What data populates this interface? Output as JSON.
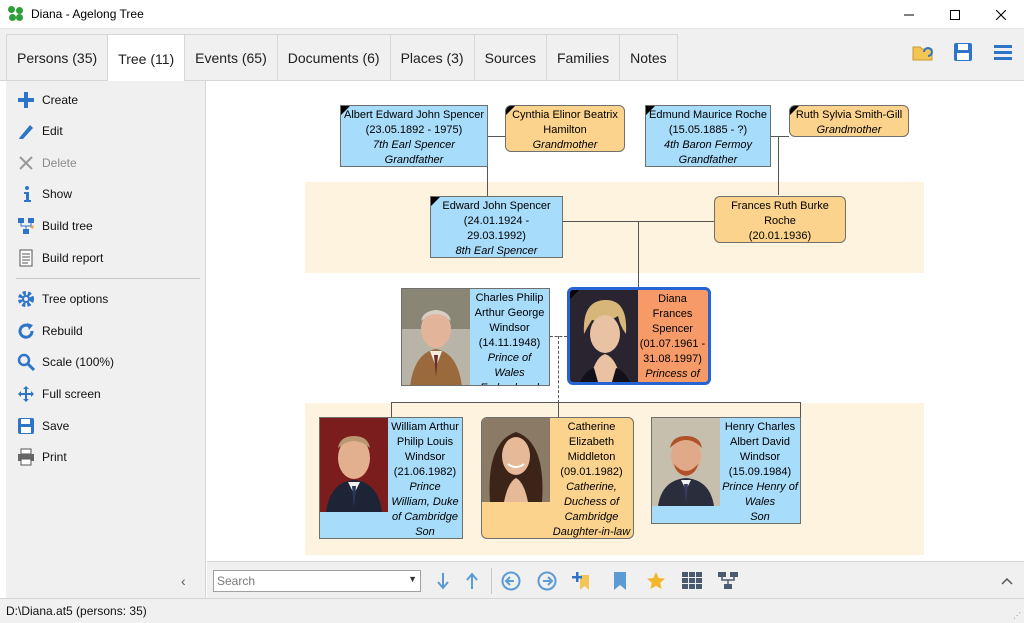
{
  "window": {
    "title": "Diana - Agelong Tree",
    "minimize": "—",
    "maximize": "☐",
    "close": "✕"
  },
  "tabs": [
    {
      "label": "Persons (35)"
    },
    {
      "label": "Tree (11)"
    },
    {
      "label": "Events (65)"
    },
    {
      "label": "Documents (6)"
    },
    {
      "label": "Places (3)"
    },
    {
      "label": "Sources"
    },
    {
      "label": "Families"
    },
    {
      "label": "Notes"
    }
  ],
  "toolbar_icons": [
    "open-folder-icon",
    "save-icon",
    "hamburger-menu-icon"
  ],
  "sidebar": {
    "items": [
      {
        "label": "Create",
        "icon": "plus-icon"
      },
      {
        "label": "Edit",
        "icon": "pencil-icon"
      },
      {
        "label": "Delete",
        "icon": "delete-x-icon"
      },
      {
        "label": "Show",
        "icon": "info-icon"
      },
      {
        "label": "Build tree",
        "icon": "build-tree-icon"
      },
      {
        "label": "Build report",
        "icon": "report-icon"
      },
      {
        "label": "Tree options",
        "icon": "gear-icon"
      },
      {
        "label": "Rebuild",
        "icon": "refresh-icon"
      },
      {
        "label": "Scale (100%)",
        "icon": "magnifier-icon"
      },
      {
        "label": "Full screen",
        "icon": "fullscreen-icon"
      },
      {
        "label": "Save",
        "icon": "save-icon"
      },
      {
        "label": "Print",
        "icon": "printer-icon"
      }
    ],
    "collapse": "‹"
  },
  "tree": {
    "albert": {
      "name": "Albert Edward John Spencer",
      "dates": "(23.05.1892 - 1975)",
      "title": "7th Earl Spencer",
      "role": "Grandfather"
    },
    "cynthia": {
      "name": "Cynthia Elinor Beatrix Hamilton",
      "role": "Grandmother"
    },
    "edmund": {
      "name": "Edmund Maurice Roche",
      "dates": "(15.05.1885 - ?)",
      "title": "4th Baron Fermoy",
      "role": "Grandfather"
    },
    "ruth": {
      "name": "Ruth Sylvia Smith-Gill",
      "role": "Grandmother"
    },
    "edward": {
      "name": "Edward John Spencer",
      "dates": "(24.01.1924 - 29.03.1992)",
      "title": "8th Earl Spencer",
      "role": "Father"
    },
    "frances": {
      "name": "Frances Ruth Burke Roche",
      "dates": "(20.01.1936)",
      "role": "Mother"
    },
    "charles": {
      "name": "Charles Philip Arthur George Windsor",
      "dates": "(14.11.1948)",
      "title": "Prince of Wales",
      "role": "Ex-husband"
    },
    "diana": {
      "name": "Diana Frances Spencer",
      "dates": "(01.07.1961 - 31.08.1997)",
      "title": "Princess of Wales"
    },
    "william": {
      "name": "William Arthur Philip Louis Windsor",
      "dates": "(21.06.1982)",
      "title": "Prince William, Duke of Cambridge",
      "role": "Son"
    },
    "catherine": {
      "name": "Catherine Elizabeth Middleton",
      "dates": "(09.01.1982)",
      "title": "Catherine, Duchess of Cambridge",
      "role": "Daughter-in-law"
    },
    "henry": {
      "name": "Henry Charles Albert David Windsor",
      "dates": "(15.09.1984)",
      "title": "Prince Henry of Wales",
      "role": "Son"
    }
  },
  "bottom_toolbar": {
    "search_placeholder": "Search",
    "icons": [
      "arrow-down-icon",
      "arrow-up-icon",
      "circle-left-icon",
      "circle-right-icon",
      "add-bookmark-icon",
      "bookmark-icon",
      "star-icon",
      "grid-icon",
      "tree-structure-icon",
      "chevron-up-icon"
    ]
  },
  "status": {
    "text": "D:\\Diana.at5 (persons: 35)"
  },
  "colors": {
    "male": "#a7dcfa",
    "female": "#fbd38c",
    "selected": "#f69b68",
    "selected_border": "#2563d7",
    "band": "#fdf3df",
    "accent": "#2e75c9"
  }
}
